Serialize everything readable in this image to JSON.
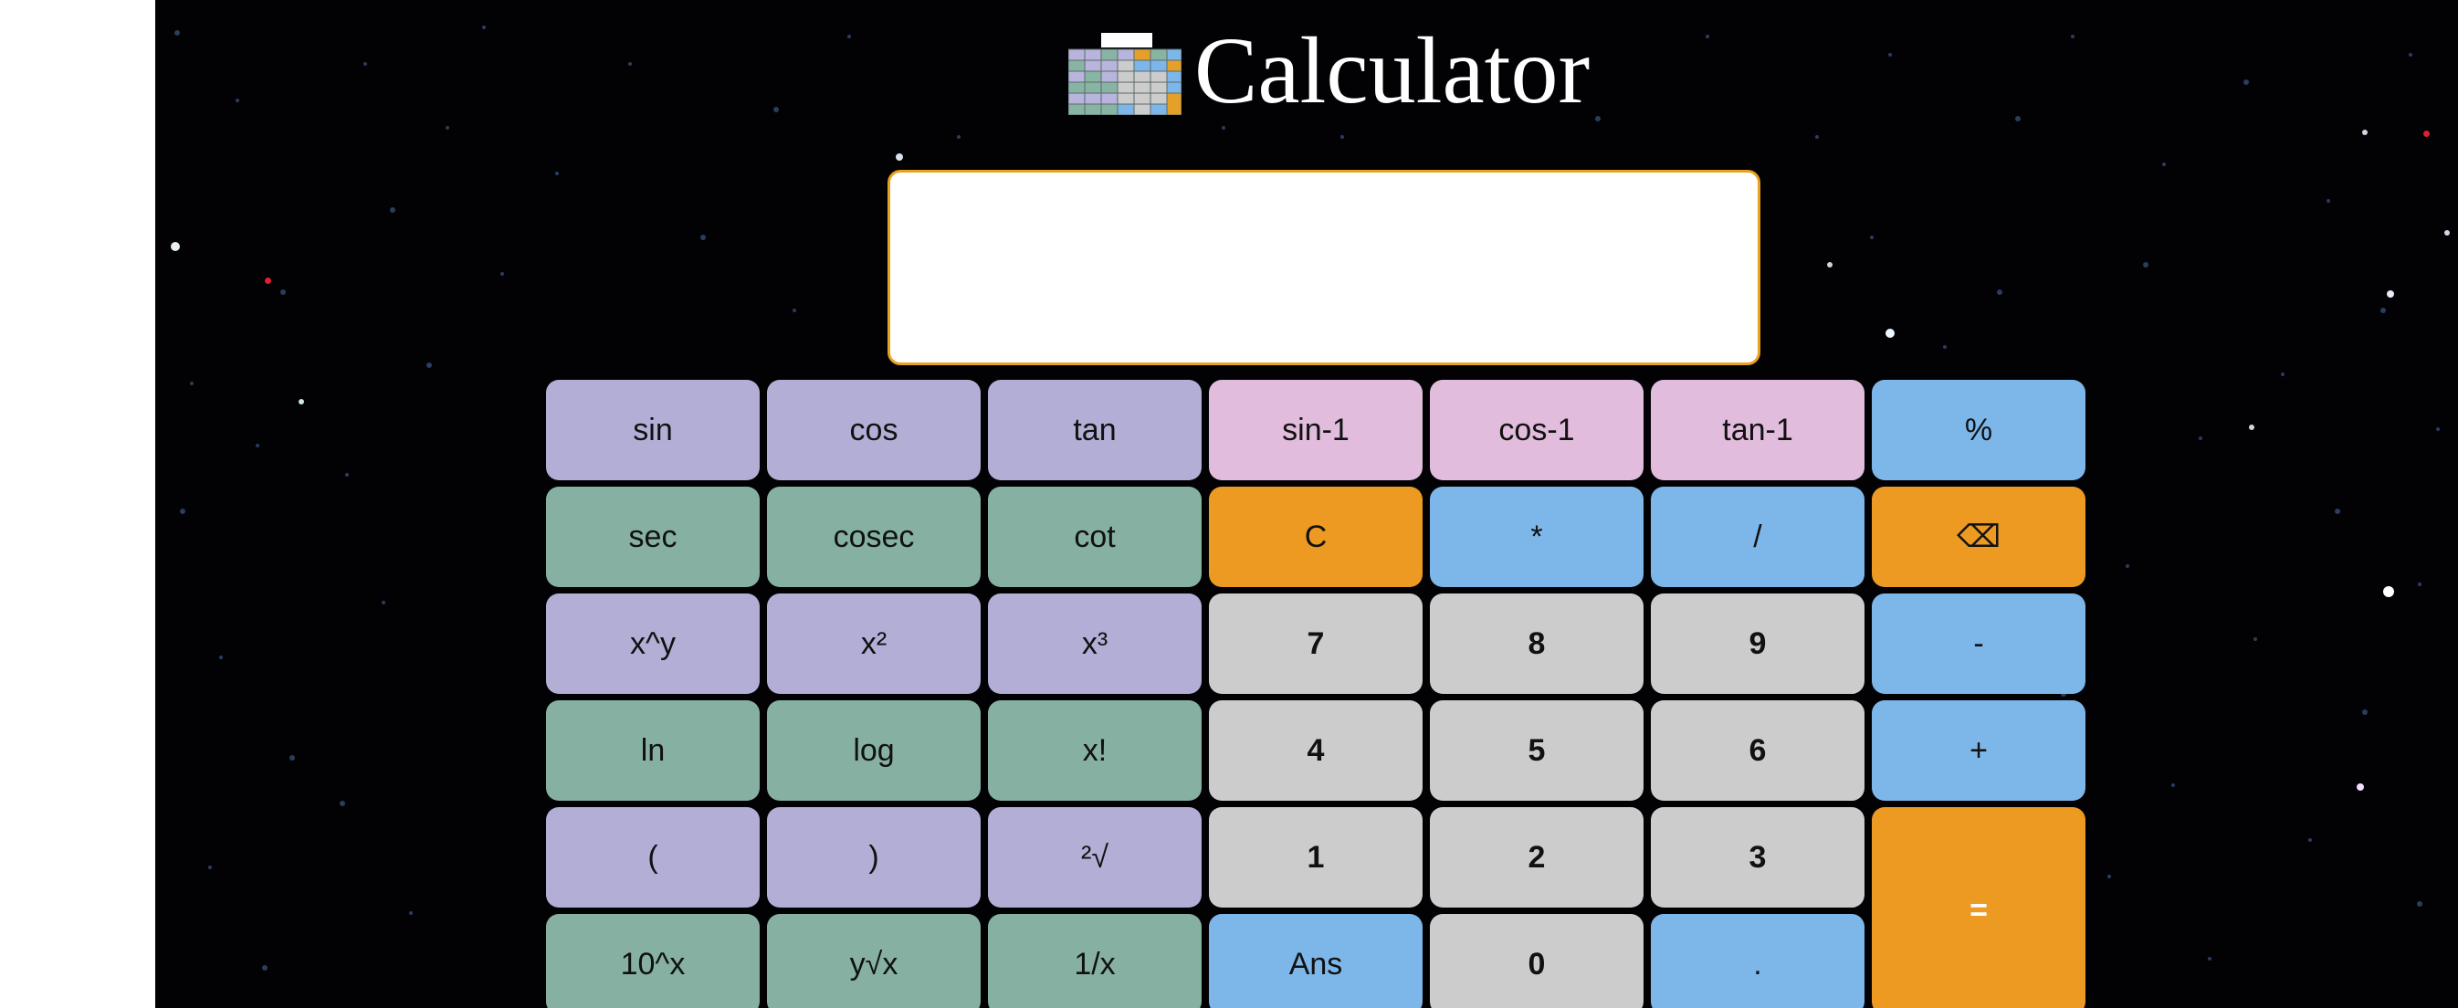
{
  "app": {
    "title": "Calculator",
    "display_value": ""
  },
  "colors": {
    "background": "#020205",
    "trig_purple": "#b3aed6",
    "inverse_pink": "#e1bcdc",
    "operator_blue": "#7db7ea",
    "function_green": "#86b1a2",
    "action_orange": "#ec9a22",
    "digit_gray": "#cccccc",
    "display_border": "#e8a21f"
  },
  "icons": {
    "title_icon": "spreadsheet-calculator-icon"
  },
  "keypad": {
    "rows": [
      [
        {
          "label": "sin",
          "color": "purple",
          "name": "sin"
        },
        {
          "label": "cos",
          "color": "purple",
          "name": "cos"
        },
        {
          "label": "tan",
          "color": "purple",
          "name": "tan"
        },
        {
          "label": "sin-1",
          "color": "pink",
          "name": "arcsin"
        },
        {
          "label": "cos-1",
          "color": "pink",
          "name": "arccos"
        },
        {
          "label": "tan-1",
          "color": "pink",
          "name": "arctan"
        },
        {
          "label": "%",
          "color": "blue",
          "name": "percent"
        }
      ],
      [
        {
          "label": "sec",
          "color": "green",
          "name": "sec"
        },
        {
          "label": "cosec",
          "color": "green",
          "name": "cosec"
        },
        {
          "label": "cot",
          "color": "green",
          "name": "cot"
        },
        {
          "label": "C",
          "color": "orange",
          "name": "clear"
        },
        {
          "label": "*",
          "color": "blue",
          "name": "multiply"
        },
        {
          "label": "/",
          "color": "blue",
          "name": "divide"
        },
        {
          "label": "⌫",
          "color": "orange",
          "name": "backspace"
        }
      ],
      [
        {
          "label": "x^y",
          "color": "purple",
          "name": "power"
        },
        {
          "label": "x²",
          "color": "purple",
          "name": "square"
        },
        {
          "label": "x³",
          "color": "purple",
          "name": "cube"
        },
        {
          "label": "7",
          "color": "gray",
          "name": "digit-7"
        },
        {
          "label": "8",
          "color": "gray",
          "name": "digit-8"
        },
        {
          "label": "9",
          "color": "gray",
          "name": "digit-9"
        },
        {
          "label": "-",
          "color": "blue",
          "name": "subtract"
        }
      ],
      [
        {
          "label": "ln",
          "color": "green",
          "name": "ln"
        },
        {
          "label": "log",
          "color": "green",
          "name": "log"
        },
        {
          "label": "x!",
          "color": "green",
          "name": "factorial"
        },
        {
          "label": "4",
          "color": "gray",
          "name": "digit-4"
        },
        {
          "label": "5",
          "color": "gray",
          "name": "digit-5"
        },
        {
          "label": "6",
          "color": "gray",
          "name": "digit-6"
        },
        {
          "label": "+",
          "color": "blue",
          "name": "add"
        }
      ],
      [
        {
          "label": "(",
          "color": "purple",
          "name": "open-paren"
        },
        {
          "label": ")",
          "color": "purple",
          "name": "close-paren"
        },
        {
          "label": "²√",
          "color": "purple",
          "name": "square-root"
        },
        {
          "label": "1",
          "color": "gray",
          "name": "digit-1"
        },
        {
          "label": "2",
          "color": "gray",
          "name": "digit-2"
        },
        {
          "label": "3",
          "color": "gray",
          "name": "digit-3"
        },
        {
          "label": "=",
          "color": "orange",
          "name": "equals",
          "span2": true
        }
      ],
      [
        {
          "label": "10^x",
          "color": "green",
          "name": "ten-power"
        },
        {
          "label": "y√x",
          "color": "green",
          "name": "nth-root"
        },
        {
          "label": "1/x",
          "color": "green",
          "name": "reciprocal"
        },
        {
          "label": "Ans",
          "color": "blue",
          "name": "answer"
        },
        {
          "label": "0",
          "color": "gray",
          "name": "digit-0"
        },
        {
          "label": ".",
          "color": "blue",
          "name": "decimal"
        }
      ]
    ]
  }
}
